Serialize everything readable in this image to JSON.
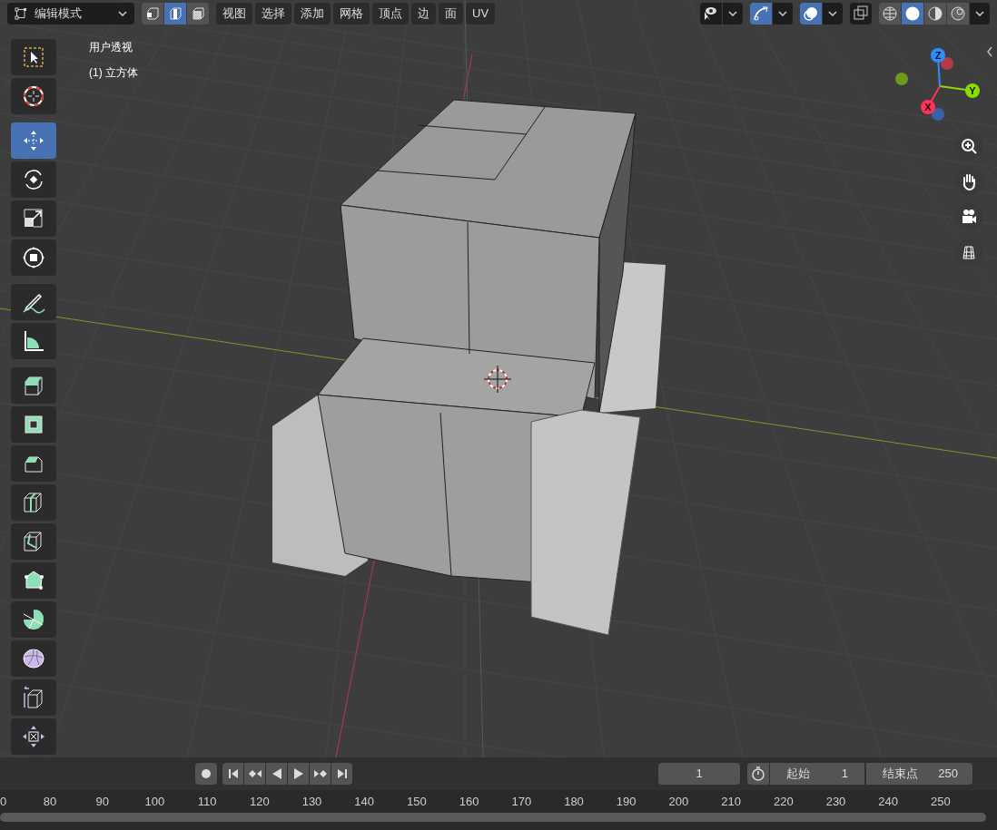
{
  "header": {
    "mode": "编辑模式",
    "select_modes": [
      {
        "kind": "vertex",
        "selected": false
      },
      {
        "kind": "edge",
        "selected": true
      },
      {
        "kind": "face",
        "selected": false
      }
    ],
    "menus": [
      "视图",
      "选择",
      "添加",
      "网格",
      "顶点",
      "边",
      "面",
      "UV"
    ],
    "toggles": [
      {
        "kind": "visibility",
        "selected": false
      },
      {
        "kind": "gizmo",
        "selected": true
      },
      {
        "kind": "overlay",
        "selected": true
      },
      {
        "kind": "xray",
        "selected": false
      }
    ],
    "shading": [
      {
        "kind": "wireframe",
        "selected": false
      },
      {
        "kind": "solid",
        "selected": true
      },
      {
        "kind": "material",
        "selected": false
      },
      {
        "kind": "rendered",
        "selected": false
      }
    ]
  },
  "viewport": {
    "view_name": "用户透视",
    "object_name": "(1) 立方体",
    "gizmo_axes": [
      {
        "kind": "z",
        "label": "Z",
        "color": "#2c8fff"
      },
      {
        "kind": "y",
        "label": "Y",
        "color": "#8bdc00"
      },
      {
        "kind": "x",
        "label": "X",
        "color": "#ff3352"
      }
    ]
  },
  "toolbar": {
    "groups": [
      [
        {
          "kind": "select_box",
          "selected": false
        },
        {
          "kind": "cursor",
          "selected": false
        }
      ],
      [
        {
          "kind": "move",
          "selected": true
        },
        {
          "kind": "rotate",
          "selected": false
        },
        {
          "kind": "scale",
          "selected": false
        },
        {
          "kind": "transform",
          "selected": false
        }
      ],
      [
        {
          "kind": "annotate",
          "selected": false
        },
        {
          "kind": "measure",
          "selected": false
        }
      ],
      [
        {
          "kind": "extrude",
          "selected": false
        },
        {
          "kind": "inset",
          "selected": false
        },
        {
          "kind": "bevel",
          "selected": false
        },
        {
          "kind": "loop_cut",
          "selected": false
        },
        {
          "kind": "knife",
          "selected": false
        },
        {
          "kind": "poly_build",
          "selected": false
        },
        {
          "kind": "spin",
          "selected": false
        },
        {
          "kind": "smooth",
          "selected": false
        },
        {
          "kind": "edge_slide",
          "selected": false
        },
        {
          "kind": "shrink",
          "selected": false
        }
      ]
    ]
  },
  "timeline": {
    "current_frame": "1",
    "start_label": "起始",
    "start": "1",
    "end_label": "结束点",
    "end": "250",
    "ruler": [
      "0",
      "80",
      "90",
      "100",
      "110",
      "120",
      "130",
      "140",
      "150",
      "160",
      "170",
      "180",
      "190",
      "200",
      "210",
      "220",
      "230",
      "240",
      "250"
    ]
  }
}
